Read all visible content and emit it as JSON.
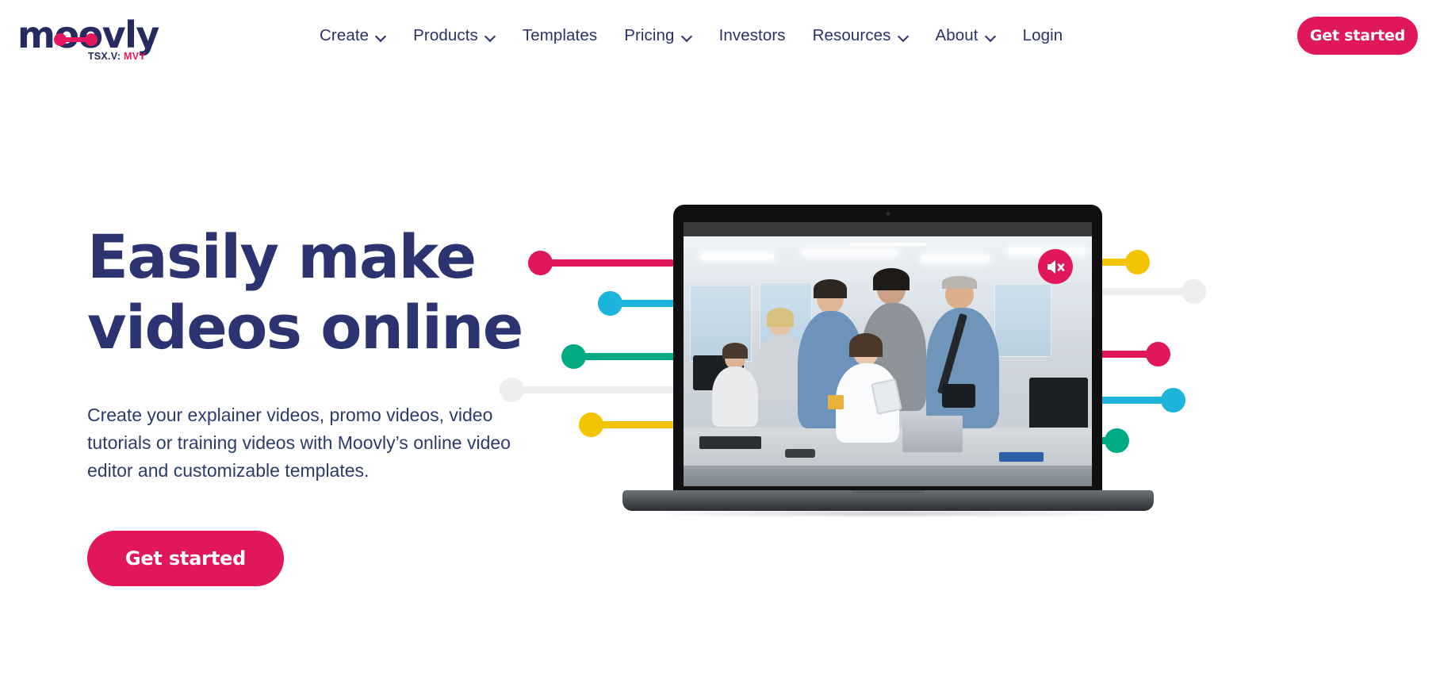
{
  "brand": {
    "name": "moovly",
    "ticker_prefix": "TSX.V:",
    "ticker_symbol": "MVY",
    "accent_pink": "#e0175c",
    "navy": "#2b3365"
  },
  "nav": {
    "items": [
      {
        "label": "Create",
        "has_dropdown": true
      },
      {
        "label": "Products",
        "has_dropdown": true
      },
      {
        "label": "Templates",
        "has_dropdown": false
      },
      {
        "label": "Pricing",
        "has_dropdown": true
      },
      {
        "label": "Investors",
        "has_dropdown": false
      },
      {
        "label": "Resources",
        "has_dropdown": true
      },
      {
        "label": "About",
        "has_dropdown": true
      },
      {
        "label": "Login",
        "has_dropdown": false
      }
    ],
    "cta_label": "Get started"
  },
  "hero": {
    "title_line1": "Easily make",
    "title_line2": "videos online",
    "subtitle": "Create your explainer videos, promo videos, video tutorials or training videos with Moovly’s online video editor and customizable templates.",
    "cta_label": "Get started"
  },
  "player": {
    "mute_icon": "speaker-mute-icon",
    "mute_badge_color": "#e0175c",
    "progress_bar_color": "#ffffff"
  },
  "connectors": {
    "left": [
      {
        "color": "#e0175c",
        "name": "pink"
      },
      {
        "color": "#1cb4db",
        "name": "cyan"
      },
      {
        "color": "#00ab84",
        "name": "teal"
      },
      {
        "color": "#eeeeee",
        "name": "light-gray"
      },
      {
        "color": "#f5c400",
        "name": "yellow"
      }
    ],
    "right": [
      {
        "color": "#f5c400",
        "name": "yellow"
      },
      {
        "color": "#eeeeee",
        "name": "light-gray"
      },
      {
        "color": "#e0175c",
        "name": "pink"
      },
      {
        "color": "#1cb4db",
        "name": "cyan"
      },
      {
        "color": "#00ab84",
        "name": "teal"
      }
    ]
  }
}
